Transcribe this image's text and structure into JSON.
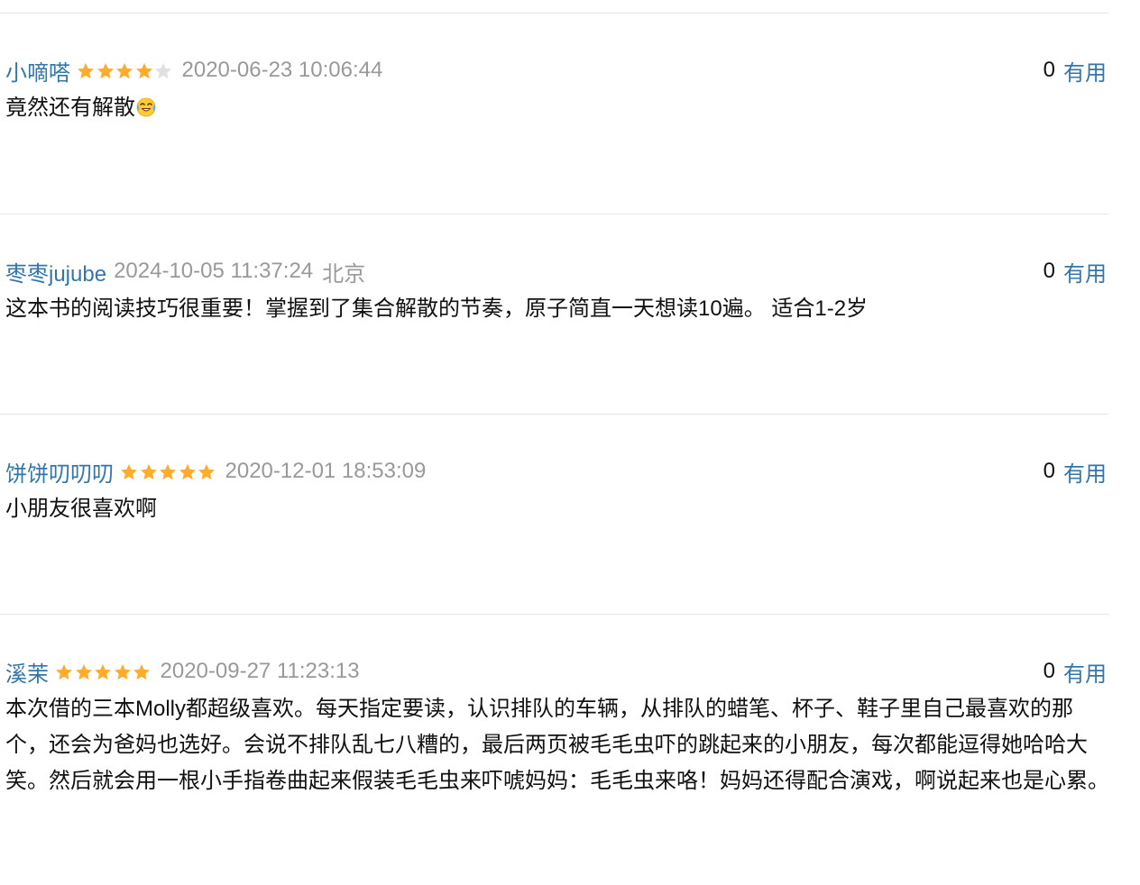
{
  "vote_label": "有用",
  "colors": {
    "link": "#3377aa",
    "meta": "#999999",
    "star_on": "#ffac2d",
    "star_off": "#e0e0e0",
    "divider": "#e5e5e5"
  },
  "comments": [
    {
      "author": "小嘀嗒",
      "rating": 4,
      "time": "2020-06-23 10:06:44",
      "location": "",
      "votes": "0",
      "content": "竟然还有解散",
      "emoji": "crying-laughing-emoji"
    },
    {
      "author": "枣枣jujube",
      "rating": 0,
      "time": "2024-10-05 11:37:24",
      "location": "北京",
      "votes": "0",
      "content": "这本书的阅读技巧很重要！掌握到了集合解散的节奏，原子简直一天想读10遍。 适合1-2岁"
    },
    {
      "author": "饼饼叨叨叨",
      "rating": 5,
      "time": "2020-12-01 18:53:09",
      "location": "",
      "votes": "0",
      "content": "小朋友很喜欢啊"
    },
    {
      "author": "溪茉",
      "rating": 5,
      "time": "2020-09-27 11:23:13",
      "location": "",
      "votes": "0",
      "content": "本次借的三本Molly都超级喜欢。每天指定要读，认识排队的车辆，从排队的蜡笔、杯子、鞋子里自己最喜欢的那个，还会为爸妈也选好。会说不排队乱七八糟的，最后两页被毛毛虫吓的跳起来的小朋友，每次都能逗得她哈哈大笑。然后就会用一根小手指卷曲起来假装毛毛虫来吓唬妈妈：毛毛虫来咯！妈妈还得配合演戏，啊说起来也是心累。"
    }
  ]
}
